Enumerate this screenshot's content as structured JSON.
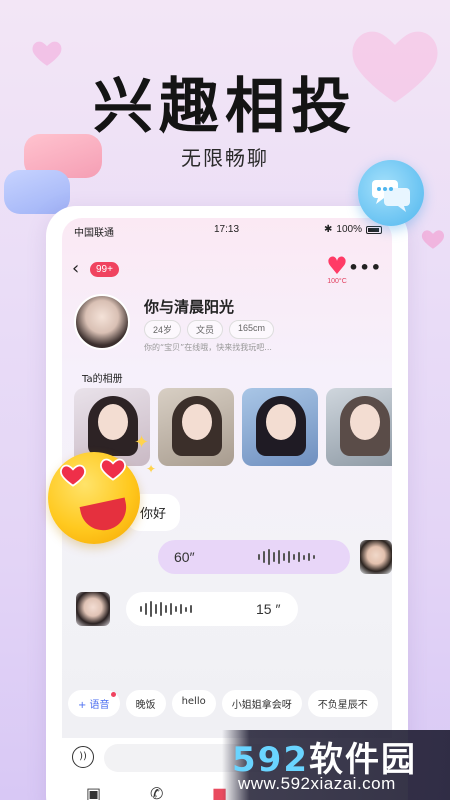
{
  "promo": {
    "headline": "兴趣相投",
    "subline": "无限畅聊"
  },
  "status_bar": {
    "carrier": "中国联通",
    "time": "17:13",
    "battery": "100%"
  },
  "nav": {
    "back_glyph": "‹",
    "unread_badge": "99+",
    "heat_value": "100°C",
    "more_glyph": "•••"
  },
  "profile": {
    "name": "你与清晨阳光",
    "tags": [
      "24岁",
      "文员",
      "165cm"
    ],
    "description": "你的“宝贝”在线哦，快来找我玩吧..."
  },
  "album": {
    "title": "Ta的相册"
  },
  "chat": {
    "hello_text": "你好",
    "outgoing_voice_length": "60″",
    "incoming_voice_length": "15 ″"
  },
  "quick_replies": {
    "voice_label": "+ 语音",
    "items": [
      "晚饭",
      "hello",
      "小姐姐拿会呀",
      "不负星辰不"
    ]
  },
  "watermark": {
    "prefix": "592",
    "suffix": "软件园",
    "url": "www.592xiazai.com"
  },
  "icons": [
    "back-icon",
    "heart-icon",
    "more-icon",
    "voice-wave-icon",
    "mic-icon",
    "image-icon",
    "phone-icon",
    "gift-icon",
    "chat-bubbles-icon",
    "emoji-heart-eyes-icon"
  ]
}
